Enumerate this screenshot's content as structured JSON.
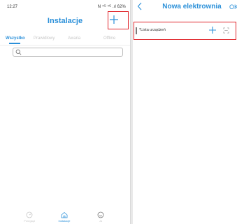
{
  "left_screen": {
    "status_bar": {
      "time": "12:27",
      "right": "N ⁴ᴳ ⁴ᴳ .ıl 62%"
    },
    "header": {
      "title": "Instalacje",
      "add_icon": "plus-icon"
    },
    "tabs": [
      {
        "label": "Wszystko",
        "active": true
      },
      {
        "label": "Prawidłowy",
        "active": false
      },
      {
        "label": "Awaria",
        "active": false
      },
      {
        "label": "Offline",
        "active": false
      }
    ],
    "search": {
      "placeholder": "",
      "value": ""
    },
    "bottom_nav": [
      {
        "label": "Przegląd",
        "icon": "overview-icon",
        "active": false
      },
      {
        "label": "Instalacje",
        "icon": "home-icon",
        "active": true
      },
      {
        "label": "Ja",
        "icon": "profile-icon",
        "active": false
      }
    ]
  },
  "right_screen": {
    "header": {
      "back_icon": "chevron-left-icon",
      "title": "Nowa elektrownia",
      "ok_label": "OK"
    },
    "device_list_row": {
      "label": "*Lista urządzeń",
      "add_icon": "plus-icon",
      "scan_icon": "scan-icon"
    }
  },
  "colors": {
    "accent": "#2b90d9",
    "highlight": "#e0252b"
  }
}
